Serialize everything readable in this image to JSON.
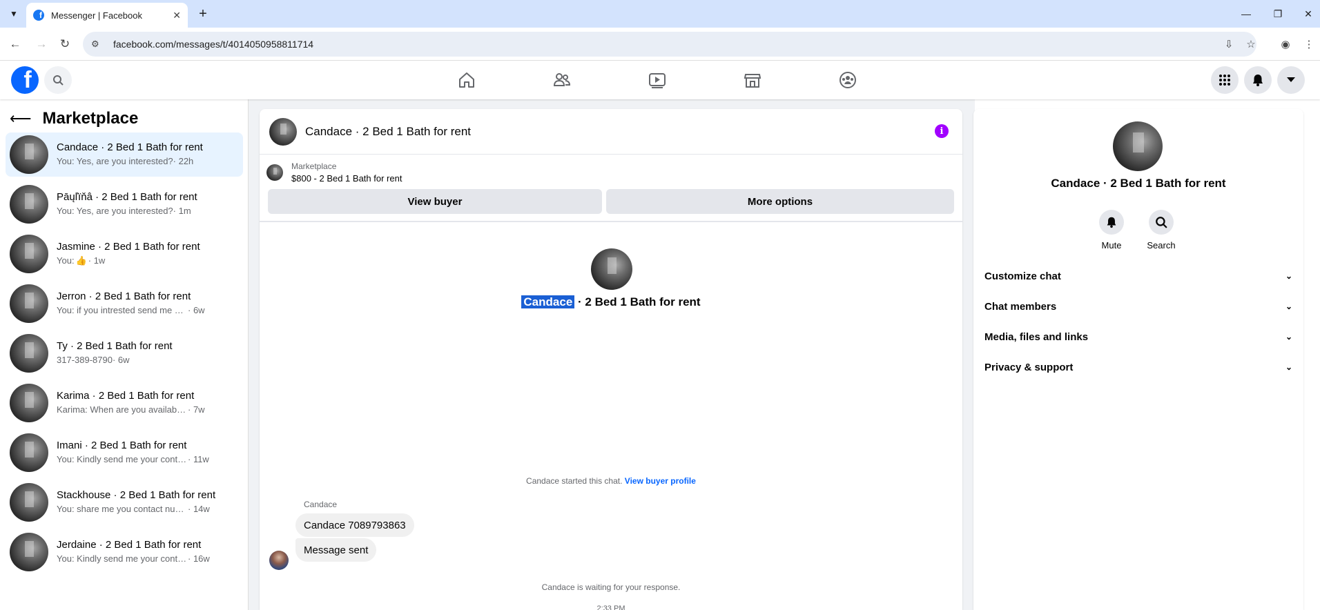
{
  "browser": {
    "tab_title": "Messenger | Facebook",
    "url": "facebook.com/messages/t/4014050958811714"
  },
  "left": {
    "title": "Marketplace",
    "conversations": [
      {
        "name": "Candace · 2 Bed 1 Bath for rent",
        "preview": "You: Yes, are you interested?",
        "time": "· 22h"
      },
      {
        "name": "Pāųľïňâ · 2 Bed 1 Bath for rent",
        "preview": "You: Yes, are you interested?",
        "time": "· 1m"
      },
      {
        "name": "Jasmine · 2 Bed 1 Bath for rent",
        "preview": "You:",
        "time": "· 1w"
      },
      {
        "name": "Jerron · 2 Bed 1 Bath for rent",
        "preview": "You: if you intrested send me your contact",
        "time": "· 6w"
      },
      {
        "name": "Ty · 2 Bed 1 Bath for rent",
        "preview": "317-389-8790",
        "time": "· 6w"
      },
      {
        "name": "Karima · 2 Bed 1 Bath for rent",
        "preview": "Karima: When are you available for showing",
        "time": "· 7w"
      },
      {
        "name": "Imani · 2 Bed 1 Bath for rent",
        "preview": "You: Kindly send me your contact number",
        "time": "· 11w"
      },
      {
        "name": "Stackhouse · 2 Bed 1 Bath for rent",
        "preview": "You: share me you contact number I will",
        "time": "· 14w"
      },
      {
        "name": "Jerdaine · 2 Bed 1 Bath for rent",
        "preview": "You: Kindly send me your contact number",
        "time": "· 16w"
      }
    ]
  },
  "chat": {
    "title": "Candace · 2 Bed 1 Bath for rent",
    "marketplace_label": "Marketplace",
    "listing": "$800 - 2 Bed 1 Bath for rent",
    "view_buyer": "View buyer",
    "more_options": "More options",
    "profile_name_highlight": "Candace",
    "profile_name_rest": " · 2 Bed 1 Bath for rent",
    "started_text": "Candace started this chat.",
    "view_buyer_profile": "View buyer profile",
    "sender": "Candace",
    "messages": [
      "Candace 7089793863",
      "Message sent"
    ],
    "waiting": "Candace is waiting for your response.",
    "time": "2:33 PM"
  },
  "details": {
    "name": "Candace · 2 Bed 1 Bath for rent",
    "mute": "Mute",
    "search": "Search",
    "sections": [
      "Customize chat",
      "Chat members",
      "Media, files and links",
      "Privacy & support"
    ]
  }
}
